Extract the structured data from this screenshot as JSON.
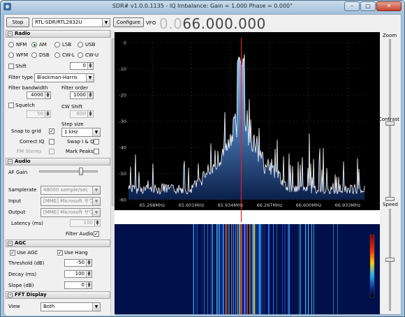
{
  "window": {
    "title": "SDR# v1.0.0.1135 - IQ Imbalance: Gain = 1.000 Phase = 0.000°",
    "minimize": "–",
    "maximize": "□",
    "close": "✕"
  },
  "toolbar": {
    "stop_label": "Stop",
    "device": "RTL-SDR/RTL2832U",
    "configure_label": "Configure",
    "vfo_label": "VFO",
    "freq_dim": "0.0",
    "freq_bright": "66.000.000"
  },
  "radio": {
    "header": "Radio",
    "modes": [
      {
        "label": "NFM",
        "selected": false
      },
      {
        "label": "AM",
        "selected": true
      },
      {
        "label": "LSB",
        "selected": false
      },
      {
        "label": "USB",
        "selected": false
      },
      {
        "label": "WFM",
        "selected": false
      },
      {
        "label": "DSB",
        "selected": false
      },
      {
        "label": "CW-L",
        "selected": false
      },
      {
        "label": "CW-U",
        "selected": false
      }
    ],
    "shift_label": "Shift",
    "shift_value": "0",
    "filter_type_label": "Filter type",
    "filter_type": "Blackman-Harris",
    "bandwidth_label": "Filter bandwidth",
    "bandwidth_value": "4000",
    "order_label": "Filter order",
    "order_value": "1000",
    "squelch_label": "Squelch",
    "squelch_value": "50",
    "cwshift_label": "CW Shift",
    "cwshift_value": "600",
    "stepsize_label": "Step size",
    "snap_label": "Snap to grid",
    "snap_checked": true,
    "step_value": "1 kHz",
    "correct_iq_label": "Correct IQ",
    "swap_iq_label": "Swap I & Q",
    "fm_stereo_label": "FM Stereo",
    "mark_peaks_label": "Mark Peaks"
  },
  "audio": {
    "header": "Audio",
    "af_gain_label": "AF Gain",
    "af_gain_level": 0.72,
    "samplerate_label": "Samplerate",
    "samplerate_value": "48000 sample/sec",
    "input_label": "Input",
    "input_value": "[MME] Microsoft サウ",
    "output_label": "Output",
    "output_value": "[MME] Microsoft サウ",
    "latency_label": "Latency (ms)",
    "latency_value": "100",
    "filter_audio_label": "Filter Audio",
    "filter_audio_checked": true
  },
  "agc": {
    "header": "AGC",
    "use_agc_label": "Use AGC",
    "use_agc_checked": true,
    "use_hang_label": "Use Hang",
    "use_hang_checked": true,
    "threshold_label": "Threshold (dB)",
    "threshold_value": "-50",
    "decay_label": "Decay (ms)",
    "decay_value": "100",
    "slope_label": "Slope (dB)",
    "slope_value": "0"
  },
  "fft": {
    "header": "FFT Display",
    "view_label": "View",
    "view_value": "Both"
  },
  "spectrum": {
    "y_ticks": [
      "0",
      "-10",
      "-20",
      "-30",
      "-40",
      "-50",
      "-60"
    ],
    "x_ticks": [
      "65.268MHz",
      "65.601MHz",
      "65.934MHz",
      "66.267MHz",
      "66.600MHz",
      "66.933MHz"
    ]
  },
  "sliders": {
    "zoom_label": "Zoom",
    "zoom_level": 0.5,
    "contrast_label": "Contrast",
    "contrast_level": 0.0,
    "speed_label": "Speed",
    "speed_level": 0.5
  },
  "colors": {
    "plot_bg": "#000000",
    "spectrum_fill_top": "#6a9ad0",
    "spectrum_line": "#ffffff",
    "center_line": "#e02020"
  }
}
